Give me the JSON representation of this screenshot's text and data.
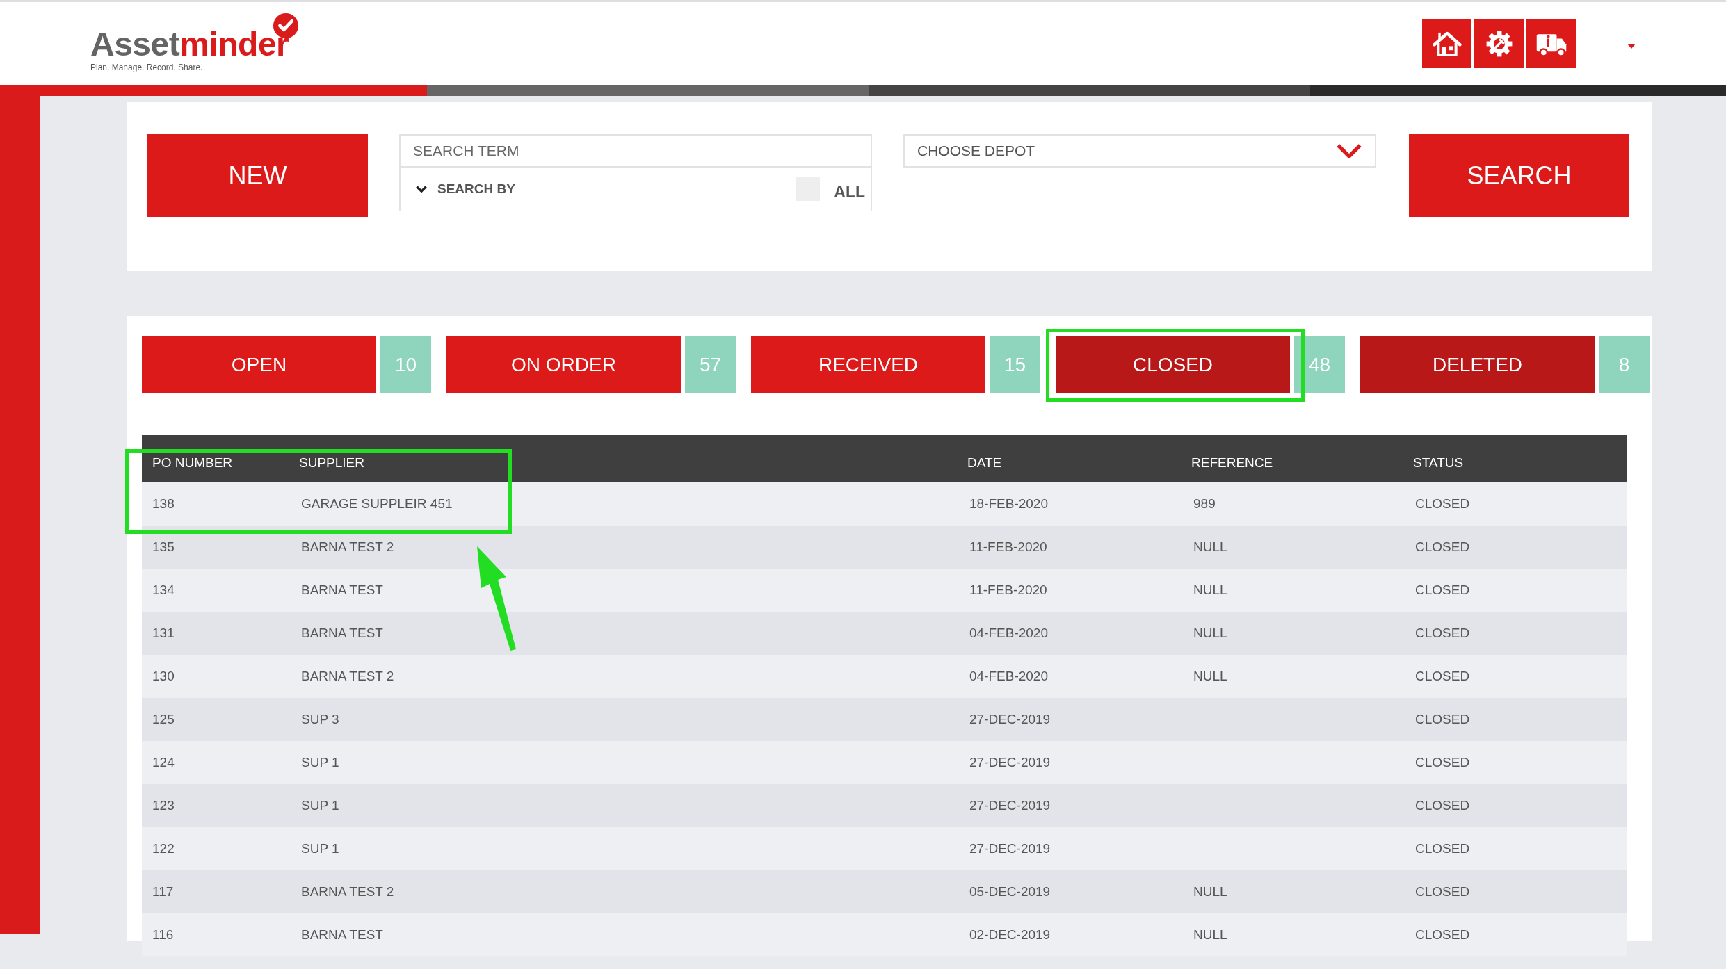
{
  "logo": {
    "name_part_1": "Asset",
    "name_part_2": "minder",
    "tagline": "Plan. Manage. Record. Share."
  },
  "search_panel": {
    "new_button": "NEW",
    "search_term": {
      "placeholder": "SEARCH TERM"
    },
    "search_by": "SEARCH BY",
    "all_checkbox": {
      "label": "ALL",
      "checked": false
    },
    "depot_select": {
      "placeholder": "CHOOSE DEPOT"
    },
    "search_button": "SEARCH"
  },
  "status_tabs": [
    {
      "label": "OPEN",
      "count": "10",
      "selected": false,
      "color": "#dc1a1a"
    },
    {
      "label": "ON ORDER",
      "count": "57",
      "selected": false,
      "color": "#dc1a1a"
    },
    {
      "label": "RECEIVED",
      "count": "15",
      "selected": false,
      "color": "#dc1a1a"
    },
    {
      "label": "CLOSED",
      "count": "48",
      "selected": true,
      "color": "#b81818"
    },
    {
      "label": "DELETED",
      "count": "8",
      "selected": false,
      "color": "#b81818"
    }
  ],
  "table": {
    "columns": [
      "PO NUMBER",
      "SUPPLIER",
      "DATE",
      "REFERENCE",
      "STATUS"
    ],
    "rows": [
      {
        "cells": [
          "138",
          "GARAGE SUPPLEIR 451",
          "18-FEB-2020",
          "989",
          "CLOSED"
        ],
        "highlighted": true
      },
      {
        "cells": [
          "135",
          "BARNA TEST 2",
          "11-FEB-2020",
          "NULL",
          "CLOSED"
        ],
        "highlighted": false
      },
      {
        "cells": [
          "134",
          "BARNA TEST",
          "11-FEB-2020",
          "NULL",
          "CLOSED"
        ],
        "highlighted": false
      },
      {
        "cells": [
          "131",
          "BARNA TEST",
          "04-FEB-2020",
          "NULL",
          "CLOSED"
        ],
        "highlighted": false
      },
      {
        "cells": [
          "130",
          "BARNA TEST 2",
          "04-FEB-2020",
          "NULL",
          "CLOSED"
        ],
        "highlighted": false
      },
      {
        "cells": [
          "125",
          "SUP 3",
          "27-DEC-2019",
          "",
          "CLOSED"
        ],
        "highlighted": false
      },
      {
        "cells": [
          "124",
          "SUP 1",
          "27-DEC-2019",
          "",
          "CLOSED"
        ],
        "highlighted": false
      },
      {
        "cells": [
          "123",
          "SUP 1",
          "27-DEC-2019",
          "",
          "CLOSED"
        ],
        "highlighted": false
      },
      {
        "cells": [
          "122",
          "SUP 1",
          "27-DEC-2019",
          "",
          "CLOSED"
        ],
        "highlighted": false
      },
      {
        "cells": [
          "117",
          "BARNA TEST 2",
          "05-DEC-2019",
          "NULL",
          "CLOSED"
        ],
        "highlighted": false
      },
      {
        "cells": [
          "116",
          "BARNA TEST",
          "02-DEC-2019",
          "NULL",
          "CLOSED"
        ],
        "highlighted": false
      }
    ]
  }
}
